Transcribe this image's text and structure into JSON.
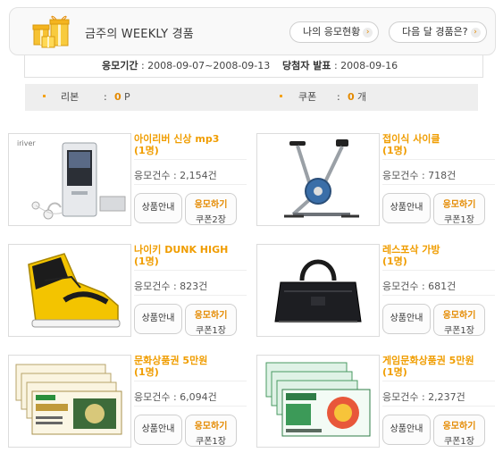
{
  "header": {
    "title": "금주의 WEEKLY 경품",
    "my_status_label": "나의 응모현황",
    "next_month_label": "다음 달 경품은?",
    "arrow": "›"
  },
  "period": {
    "apply_label": "응모기간",
    "apply_value": ": 2008-09-07~2008-09-13",
    "winner_label": "당첨자 발표",
    "winner_value": ": 2008-09-16"
  },
  "stats": {
    "ribbon_label": "리본",
    "ribbon_colon": ":",
    "ribbon_value": "0",
    "ribbon_unit": "P",
    "coupon_label": "쿠폰",
    "coupon_colon": ":",
    "coupon_value": "0",
    "coupon_unit": "개"
  },
  "products": [
    {
      "name": "아이리버 신상 mp3",
      "qty": "(1명)",
      "count": "응모건수 : 2,154건",
      "info": "상품안내",
      "apply": "응모하기",
      "coupon": "쿠폰2장",
      "brand": "iriver",
      "icon": "mp3-player-icon"
    },
    {
      "name": "접이식 사이클",
      "qty": "(1명)",
      "count": "응모건수 : 718건",
      "info": "상품안내",
      "apply": "응모하기",
      "coupon": "쿠폰1장",
      "icon": "exercise-bike-icon"
    },
    {
      "name": "나이키 DUNK HIGH",
      "qty": "(1명)",
      "count": "응모건수 : 823건",
      "info": "상품안내",
      "apply": "응모하기",
      "coupon": "쿠폰1장",
      "icon": "sneaker-icon"
    },
    {
      "name": "레스포삭 가방",
      "qty": "(1명)",
      "count": "응모건수 : 681건",
      "info": "상품안내",
      "apply": "응모하기",
      "coupon": "쿠폰1장",
      "icon": "bag-icon"
    },
    {
      "name": "문화상품권 5만원",
      "qty": "(1명)",
      "count": "응모건수 : 6,094건",
      "info": "상품안내",
      "apply": "응모하기",
      "coupon": "쿠폰1장",
      "icon": "gift-certificate-icon"
    },
    {
      "name": "게임문화상품권 5만원",
      "qty": "(1명)",
      "count": "응모건수 : 2,237건",
      "info": "상품안내",
      "apply": "응모하기",
      "coupon": "쿠폰1장",
      "icon": "game-voucher-icon"
    }
  ],
  "colors": {
    "accent": "#f09d00",
    "stats_bg": "#eeeeee",
    "border": "#dcdcdc"
  }
}
